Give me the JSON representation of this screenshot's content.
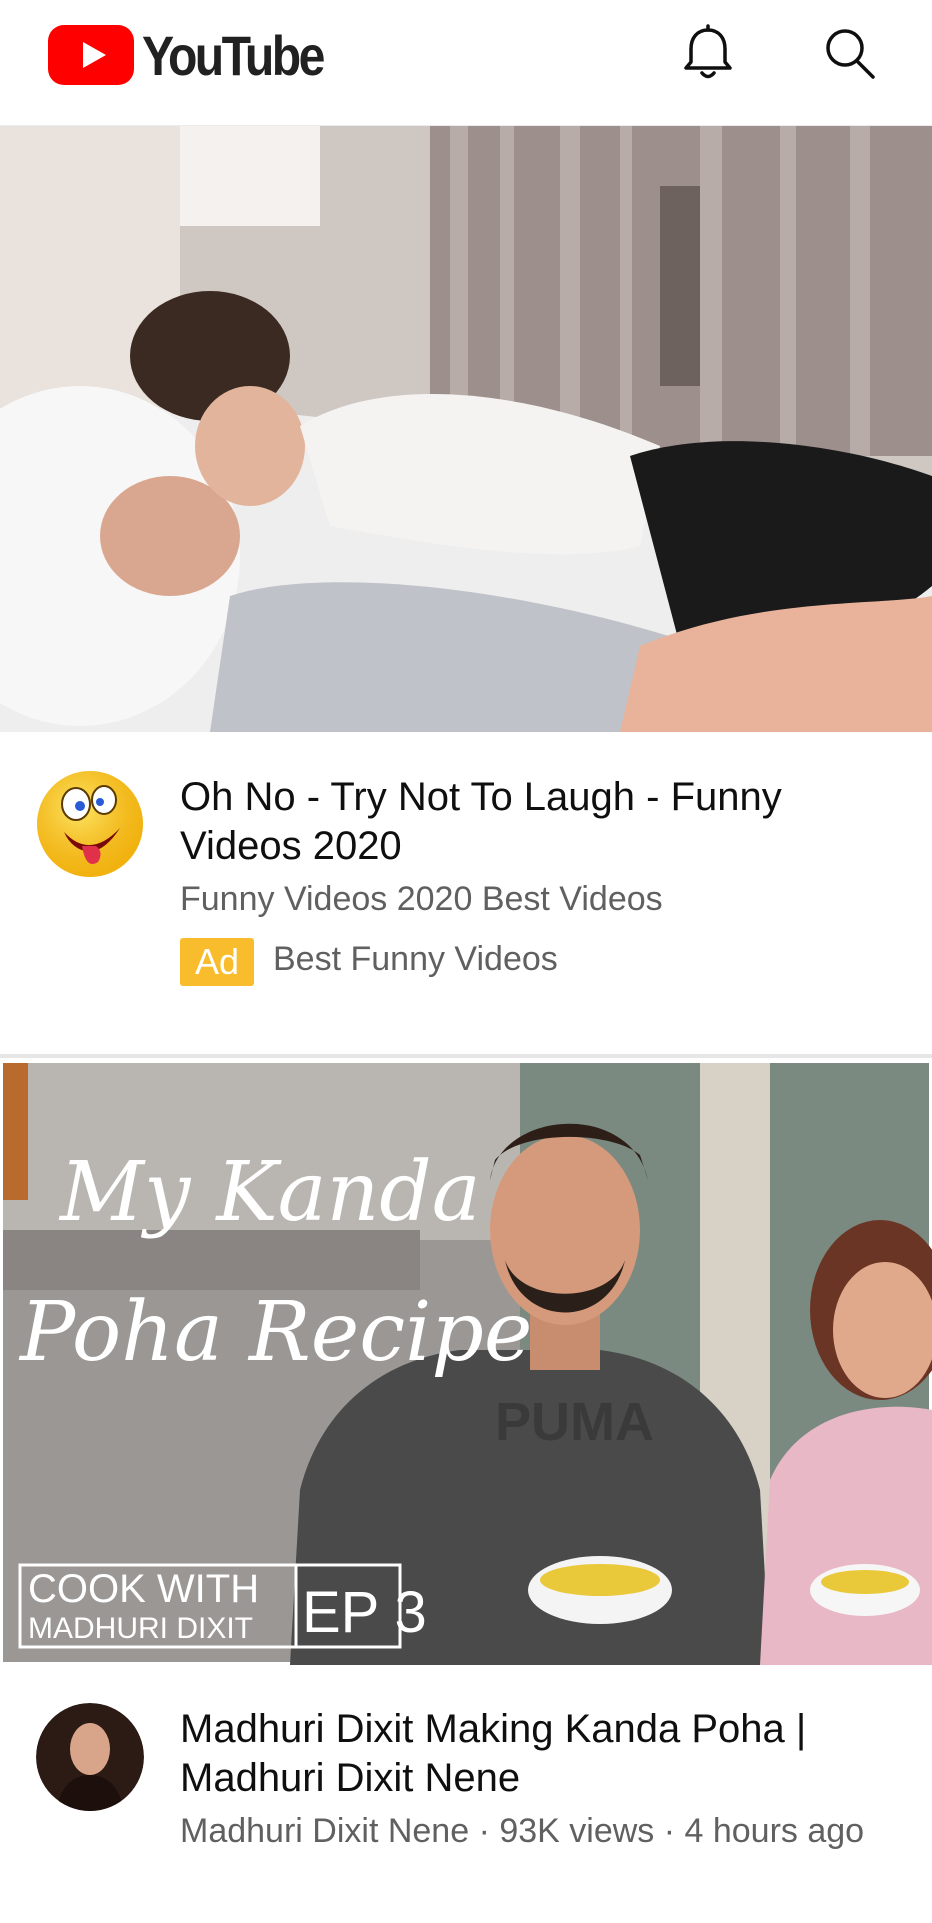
{
  "header": {
    "logo_text": "YouTube",
    "icons": [
      "notifications-icon",
      "search-icon"
    ]
  },
  "videos": [
    {
      "title": "Oh No - Try Not To Laugh - Funny Videos 2020",
      "channel": "Funny Videos 2020 Best Videos",
      "ad_label": "Ad",
      "advertiser": "Best Funny Videos",
      "thumbnail": "thumbnail-photo"
    },
    {
      "title": "Madhuri Dixit Making Kanda Poha | Madhuri Dixit Nene",
      "subtitle": "Madhuri Dixit Nene · 93K views · 4 hours ago",
      "thumbnail": {
        "script_line1": "My Kanda",
        "script_line2": "Poha Recipe",
        "series_line1": "COOK WITH",
        "series_line2": "MADHURI DIXIT",
        "episode": "EP 3",
        "shirt_text": "PUMA"
      }
    }
  ],
  "colors": {
    "brand_red": "#ff0000",
    "ad_badge": "#f9bc2d",
    "secondary_text": "#606060"
  }
}
